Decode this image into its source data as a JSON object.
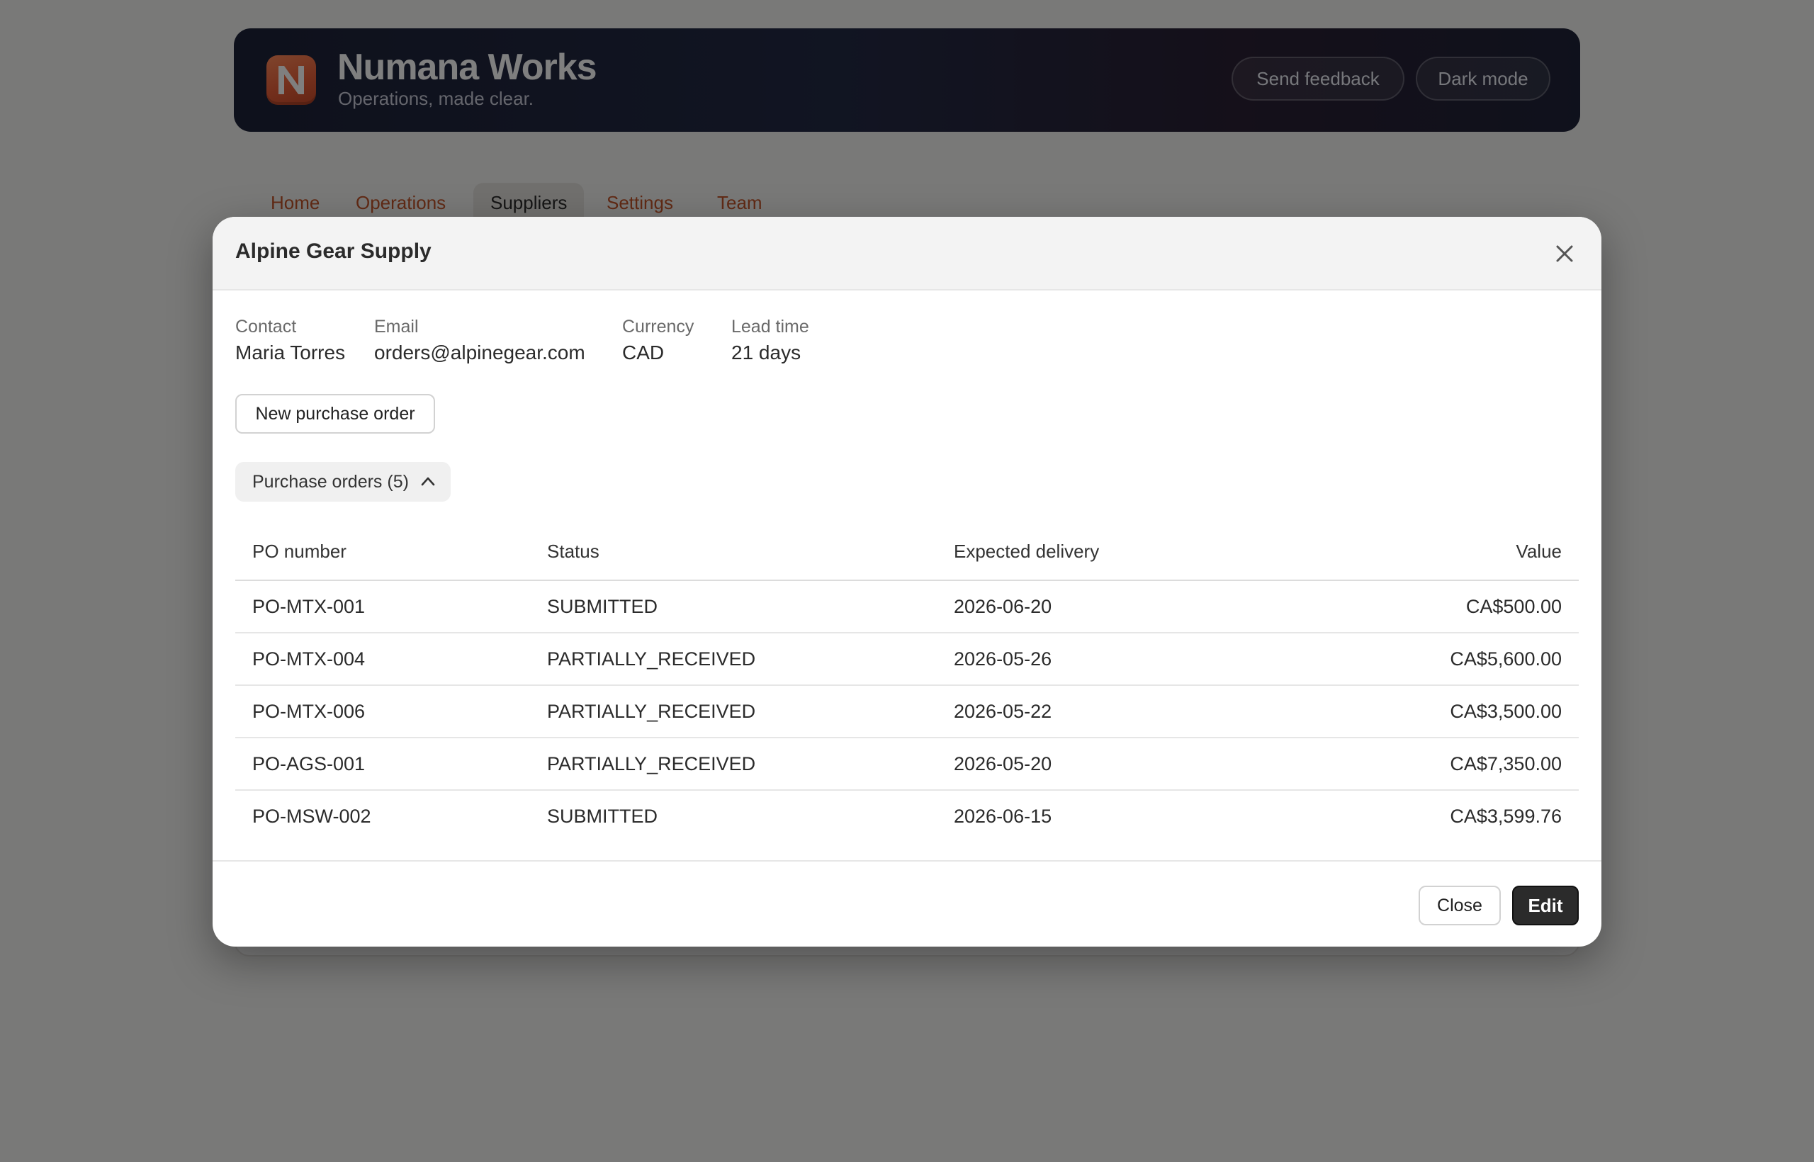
{
  "app": {
    "brand_initial": "N",
    "title": "Numana Works",
    "tagline": "Operations, made clear.",
    "send_feedback_label": "Send feedback",
    "dark_mode_label": "Dark mode",
    "logo_color": "#e8603a"
  },
  "nav": {
    "tabs": [
      {
        "label": "Home",
        "active": false
      },
      {
        "label": "Operations",
        "active": false
      },
      {
        "label": "Suppliers",
        "active": true
      },
      {
        "label": "Settings",
        "active": false
      },
      {
        "label": "Team",
        "active": false
      }
    ],
    "tab_color": "#c2552a"
  },
  "modal": {
    "title": "Alpine Gear Supply",
    "details": [
      {
        "label": "Contact",
        "value": "Maria Torres"
      },
      {
        "label": "Email",
        "value": "orders@alpinegear.com"
      },
      {
        "label": "Currency",
        "value": "CAD"
      },
      {
        "label": "Lead time",
        "value": "21 days"
      }
    ],
    "new_po_label": "New purchase order",
    "orders_toggle_label": "Purchase orders (5)",
    "orders_expanded": true,
    "table": {
      "columns": [
        "PO number",
        "Status",
        "Expected delivery",
        "Value"
      ],
      "rows": [
        [
          "PO-MTX-001",
          "SUBMITTED",
          "2026-06-20",
          "CA$500.00"
        ],
        [
          "PO-MTX-004",
          "PARTIALLY_RECEIVED",
          "2026-05-26",
          "CA$5,600.00"
        ],
        [
          "PO-MTX-006",
          "PARTIALLY_RECEIVED",
          "2026-05-22",
          "CA$3,500.00"
        ],
        [
          "PO-AGS-001",
          "PARTIALLY_RECEIVED",
          "2026-05-20",
          "CA$7,350.00"
        ],
        [
          "PO-MSW-002",
          "SUBMITTED",
          "2026-06-15",
          "CA$3,599.76"
        ]
      ]
    },
    "close_label": "Close",
    "edit_label": "Edit"
  }
}
